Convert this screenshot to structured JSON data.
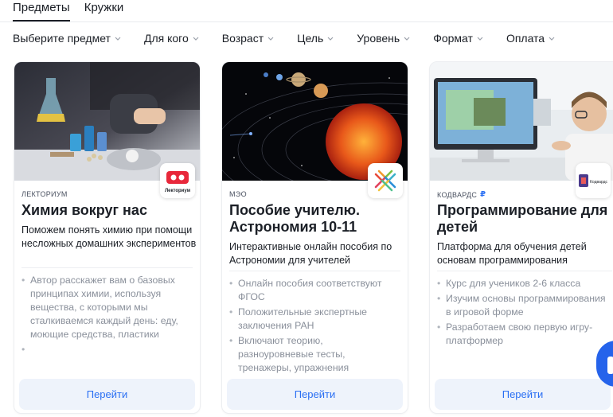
{
  "tabs": [
    {
      "label": "Предметы",
      "active": true
    },
    {
      "label": "Кружки",
      "active": false
    }
  ],
  "filters": [
    {
      "label": "Выберите предмет"
    },
    {
      "label": "Для кого"
    },
    {
      "label": "Возраст"
    },
    {
      "label": "Цель"
    },
    {
      "label": "Уровень"
    },
    {
      "label": "Формат"
    },
    {
      "label": "Оплата"
    }
  ],
  "cards": [
    {
      "provider": "ЛЕКТОРИУМ",
      "logo_text": "Лекториум",
      "title": "Химия вокруг нас",
      "description": "Поможем понять химию при помощи несложных домашних экспериментов",
      "bullets": [
        "Автор расскажет вам о базовых принципах химии, используя вещества, с которыми мы сталкиваемся каждый день: еду, моющие средства, пластики",
        ""
      ],
      "button_label": "Перейти"
    },
    {
      "provider": "МЭО",
      "title": "Пособие учителю. Астрономия 10-11",
      "description": "Интерактивные онлайн пособия по Астрономии для учителей",
      "bullets": [
        "Онлайн пособия соответствуют ФГОС",
        "Положительные экспертные заключения РАН",
        "Включают теорию, разноуровневые тесты, тренажеры, упражнения"
      ],
      "button_label": "Перейти"
    },
    {
      "provider": "КОДВАРДС",
      "provider_badge": "₽",
      "logo_text": "Кодвардс",
      "title": "Программирование для детей",
      "description": "Платформа для обучения детей основам программирования",
      "bullets": [
        "Курс для учеников 2-6 класса",
        "Изучим основы программирования в игровой форме",
        "Разработаем свою первую игру-платформер"
      ],
      "button_label": "Перейти"
    }
  ],
  "colors": {
    "accent": "#2a6ff3",
    "button_bg": "#eef3fb",
    "muted_text": "#8a909b"
  }
}
